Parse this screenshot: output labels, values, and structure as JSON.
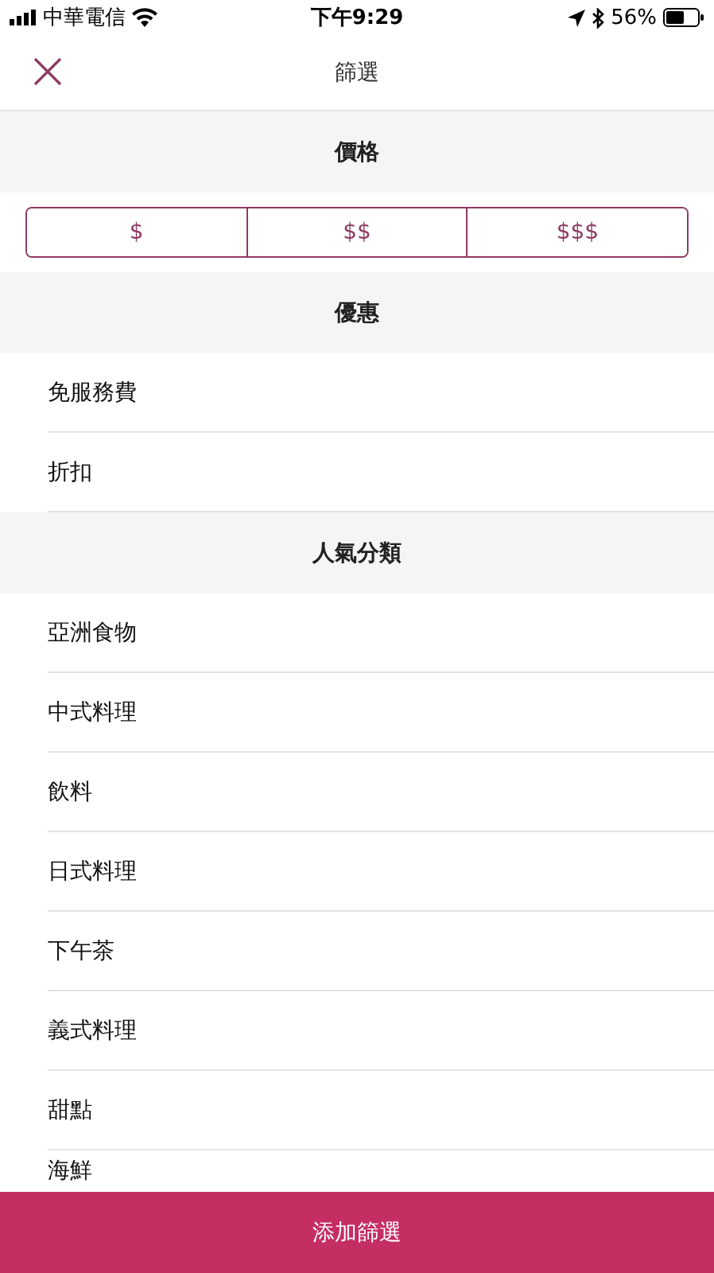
{
  "status_bar": {
    "carrier": "中華電信",
    "time": "下午9:29",
    "battery": "56%"
  },
  "header": {
    "title": "篩選"
  },
  "sections": [
    {
      "title": "價格",
      "kind": "segments",
      "options": [
        {
          "label": "$",
          "selected": false
        },
        {
          "label": "$$",
          "selected": false
        },
        {
          "label": "$$$",
          "selected": false
        }
      ]
    },
    {
      "title": "優惠",
      "kind": "list",
      "items": [
        "免服務費",
        "折扣"
      ]
    },
    {
      "title": "人氣分類",
      "kind": "list",
      "items": [
        "亞洲食物",
        "中式料理",
        "飲料",
        "日式料理",
        "下午茶",
        "義式料理",
        "甜點",
        "海鮮"
      ]
    }
  ],
  "footer_button": "添加篩選"
}
